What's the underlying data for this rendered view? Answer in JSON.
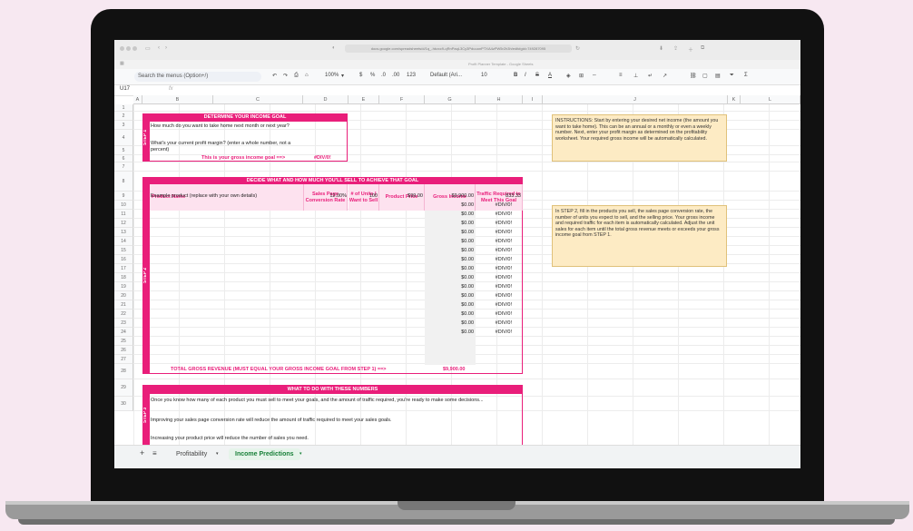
{
  "browser": {
    "url": "docs.google.com/spreadsheets/d/1q_-hkvcc9-qRnPaqL3Cy3PduuonPTXA4zPW5r2h3h/edit#gid=749287095",
    "tab_title": "Profit Planner Template - Google Sheets"
  },
  "toolbar": {
    "search_placeholder": "Search the menus (Option+/)",
    "zoom": "100%",
    "currency": "$",
    "percent": "%",
    "decrease_decimal": ".0",
    "increase_decimal": ".00",
    "format_more": "123",
    "font": "Default (Ari...",
    "font_size": "10",
    "bold": "B",
    "italic": "I",
    "strike": "S",
    "text_color": "A"
  },
  "formula_bar": {
    "cell_ref": "U17",
    "fx": "fx"
  },
  "columns": [
    "A",
    "B",
    "C",
    "D",
    "E",
    "F",
    "G",
    "H",
    "I",
    "J",
    "K",
    "L"
  ],
  "rows": [
    "1",
    "2",
    "3",
    "4",
    "5",
    "6",
    "7",
    "8",
    "9",
    "10",
    "11",
    "12",
    "13",
    "14",
    "15",
    "16",
    "17",
    "18",
    "19",
    "20",
    "21",
    "22",
    "23",
    "24",
    "25",
    "26",
    "27",
    "28",
    "29",
    "30"
  ],
  "step1": {
    "label": "STEP 1",
    "title": "DETERMINE YOUR INCOME GOAL",
    "q1": "How much do you want to take home next month or next year?",
    "q2": "What's your current profit margin? (enter a whole number, not a percent)",
    "goal_label": "This is your gross income goal ==>",
    "goal_value": "#DIV/0!"
  },
  "step2": {
    "label": "STEP 2",
    "title": "DECIDE WHAT AND HOW MUCH YOU'LL SELL TO ACHIEVE THAT GOAL",
    "headers": [
      "Product Name",
      "Sales Page Conversion Rate",
      "# of Units I Want to Sell",
      "Product Price",
      "Gross Income",
      "Traffic Required to Meet This Goal"
    ],
    "first_row": {
      "name": "Example product (replace with your own details)",
      "rate": "12.00%",
      "units": "100",
      "price": "$99.00",
      "gross": "$9,900.00",
      "traffic": "833.33"
    },
    "empty_gross": "$0.00",
    "empty_traffic": "#DIV/0!",
    "total_label": "TOTAL GROSS REVENUE (MUST EQUAL YOUR GROSS INCOME GOAL FROM STEP 1) ==>",
    "total_value": "$9,900.00"
  },
  "step3": {
    "label": "STEP 3",
    "title": "WHAT TO DO WITH THESE NUMBERS",
    "line1": "Once you know how many of each product you must sell to meet your goals, and the amount of traffic required, you're ready to make some decisions...",
    "line2": "Improving your sales page conversion rate will reduce the amount of traffic required to meet your sales goals.",
    "line3": "Increasing your product price will reduce the number of sales you need."
  },
  "notes": {
    "n1": "INSTRUCTIONS: Start by entering your desired net income (the amount you want to take home). This can be an annual or a monthly or even a weekly number. Next, enter your profit margin as determined on the profitability worksheet. Your required gross income will be automatically calculated.",
    "n2": "In STEP 2, fill in the products you sell, the sales page conversion rate, the number of units you expect to sell, and the selling price. Your gross income and required traffic for each item is automatically calculated. Adjust the unit sales for each item until the total gross revenue meets or exceeds your gross income goal from STEP 1."
  },
  "sheet_tabs": {
    "add": "+",
    "list": "≡",
    "tab1": "Profitability",
    "tab2": "Income Predictions"
  },
  "colors": {
    "accent": "#e91e7a",
    "note_bg": "#fdebc4",
    "active_tab": "#188038"
  }
}
